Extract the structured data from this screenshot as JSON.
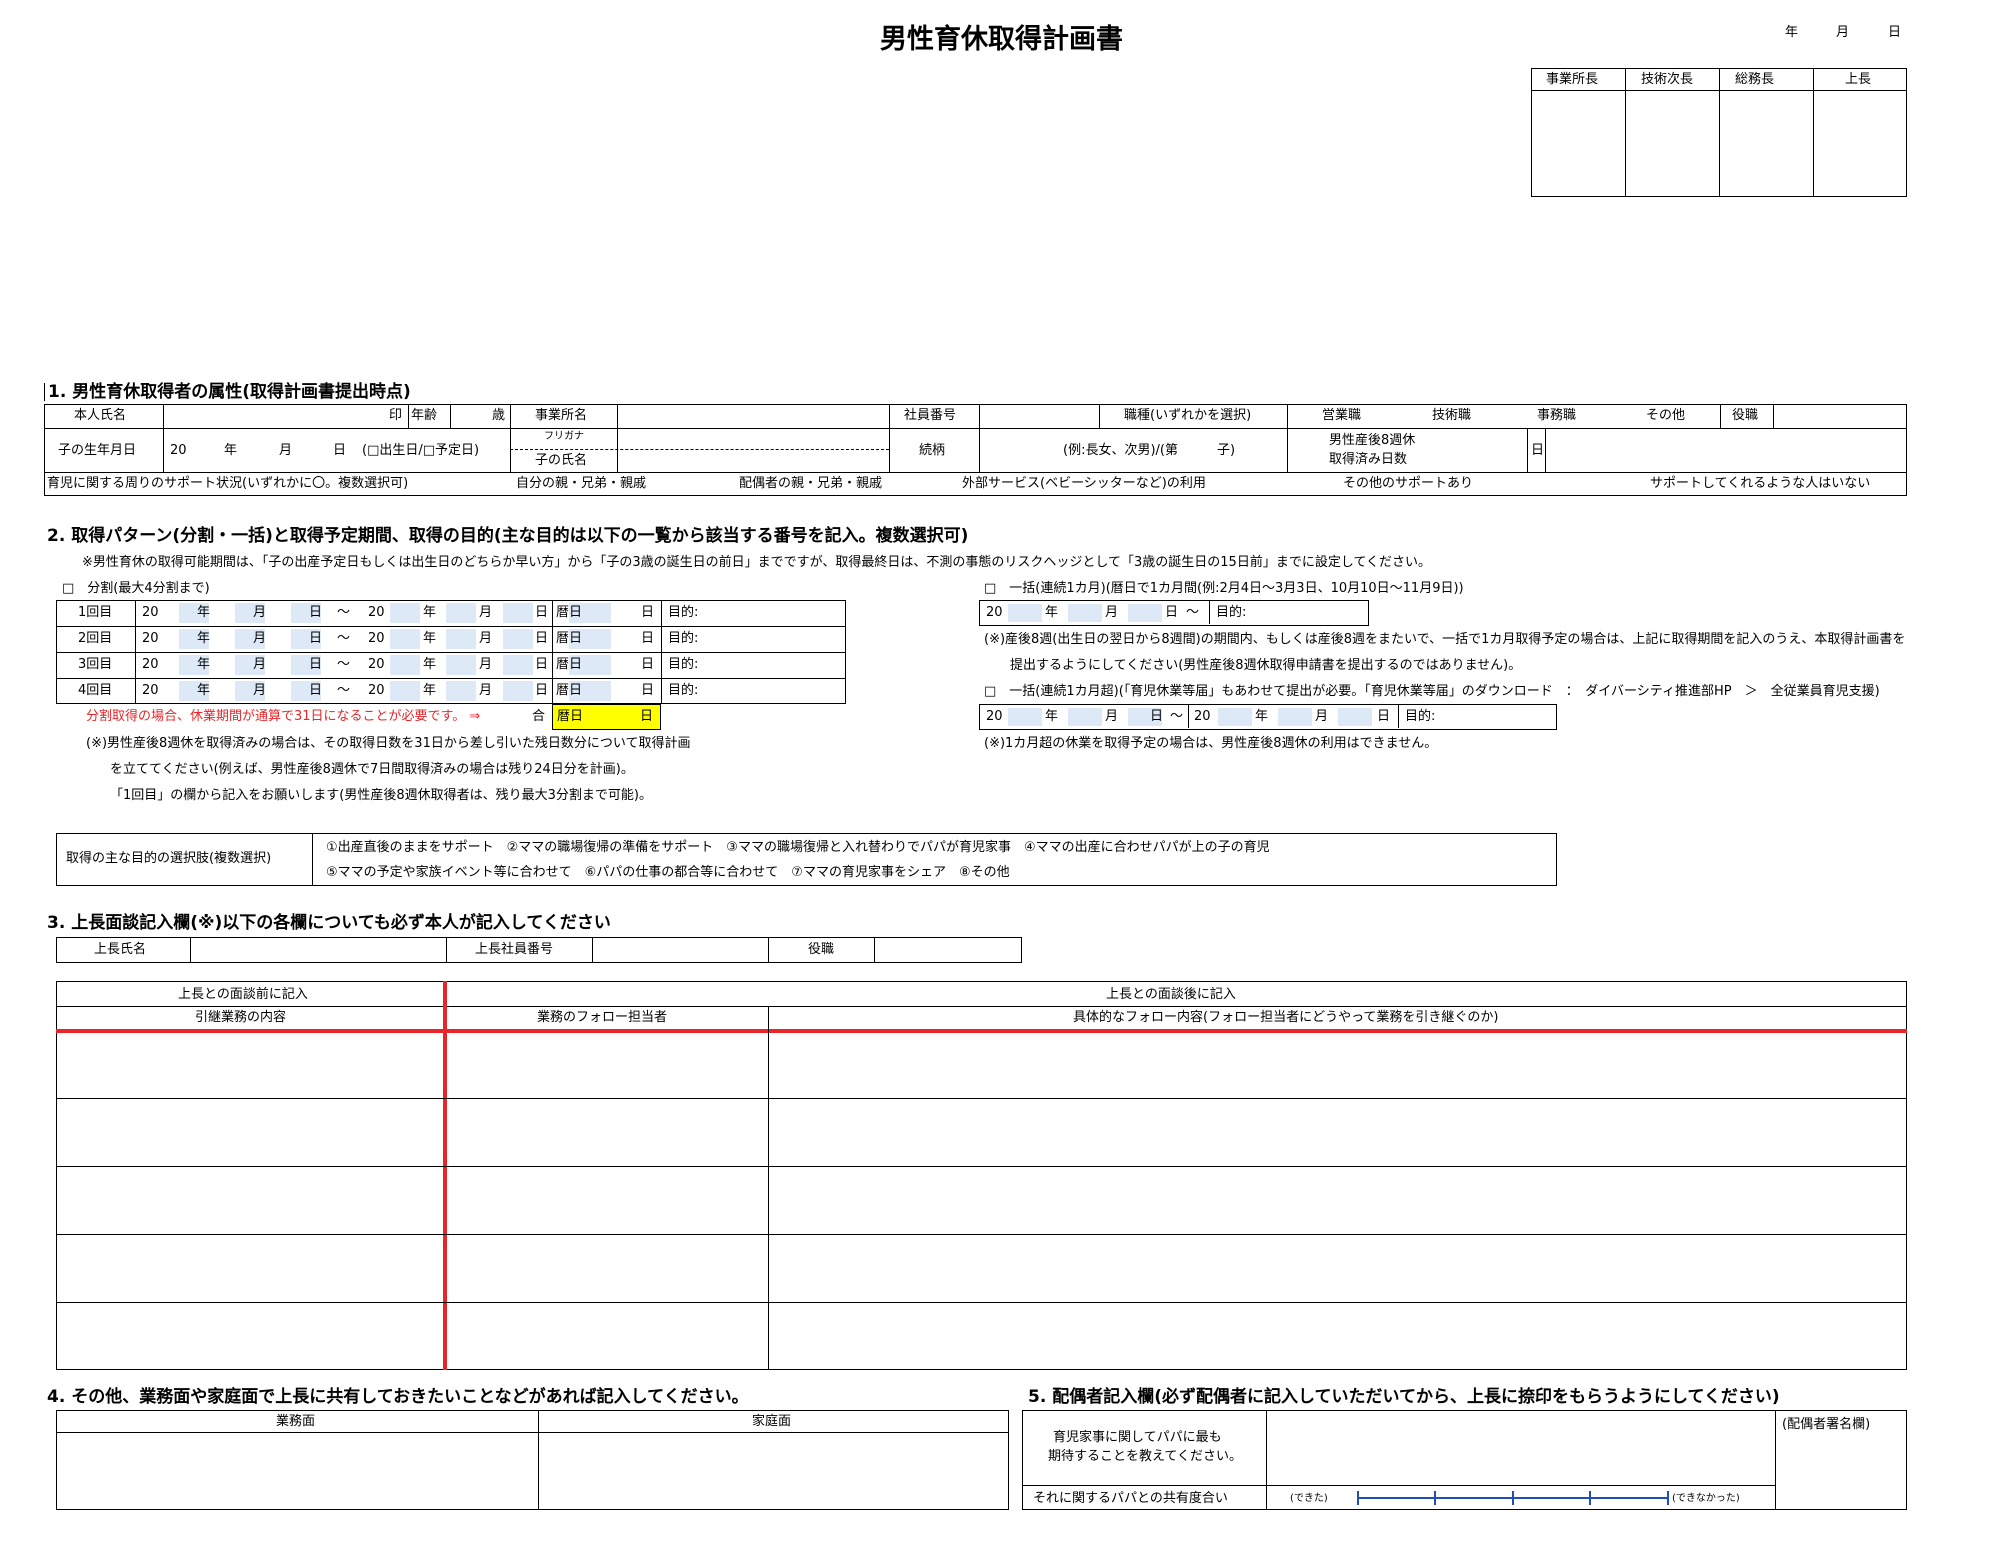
{
  "title": "男性育休取得計画書",
  "date": {
    "year": "年",
    "month": "月",
    "day": "日"
  },
  "approvals": [
    "事業所長",
    "技術次長",
    "総務長",
    "上長"
  ],
  "s1": {
    "heading": "1. 男性育休取得者の属性(取得計画書提出時点)",
    "name_label": "本人氏名",
    "seal": "印",
    "age_label": "年齢",
    "age_unit": "歳",
    "office_label": "事業所名",
    "empno_label": "社員番号",
    "job_label": "職種(いずれかを選択)",
    "jobs": [
      "営業職",
      "技術職",
      "事務職",
      "その他",
      "役職"
    ],
    "dob_label": "子の生年月日",
    "dob_20": "20",
    "dob_y": "年",
    "dob_m": "月",
    "dob_d": "日",
    "dob_opts": "(□出生日/□予定日)",
    "furigana": "フリガナ",
    "child_name": "子の氏名",
    "relation_label": "続柄",
    "relation_ex": "(例:長女、次男)/(第　　　子)",
    "paternity_l1": "男性産後8週休",
    "paternity_l2": "取得済み日数",
    "paternity_unit": "日",
    "support_label": "育児に関する周りのサポート状況(いずれかに〇。複数選択可)",
    "supports": [
      "自分の親・兄弟・親戚",
      "配偶者の親・兄弟・親戚",
      "外部サービス(ベビーシッターなど)の利用",
      "その他のサポートあり",
      "サポートしてくれるような人はいない"
    ]
  },
  "s2": {
    "heading": "2. 取得パターン(分割・一括)と取得予定期間、取得の目的(主な目的は以下の一覧から該当する番号を記入。複数選択可)",
    "note": "※男性育休の取得可能期間は、「子の出産予定日もしくは出生日のどちらか早い方」から「子の3歳の誕生日の前日」までですが、取得最終日は、不測の事態のリスクヘッジとして「3歳の誕生日の15日前」までに設定してください。",
    "split_label": "□　分割(最大4分割まで)",
    "rows": [
      "1回目",
      "2回目",
      "3回目",
      "4回目"
    ],
    "p20": "20",
    "py": "年",
    "pm": "月",
    "pd": "日",
    "tilde": "～",
    "cal": "暦日",
    "cal_d": "日",
    "purpose": "目的:",
    "split_warn": "分割取得の場合、休業期間が通算で31日になることが必要です。 ⇒",
    "split_total": "合",
    "split_total_cal": "暦日",
    "split_total_d": "日",
    "split_note1": "(※)男性産後8週休を取得済みの場合は、その取得日数を31日から差し引いた残日数分について取得計画",
    "split_note2": "を立ててください(例えば、男性産後8週休で7日間取得済みの場合は残り24日分を計画)。",
    "split_note3": "「1回目」の欄から記入をお願いします(男性産後8週休取得者は、残り最大3分割まで可能)。",
    "bulk1_label": "□　一括(連続1カ月)(暦日で1カ月間(例:2月4日～3月3日、10月10日～11月9日))",
    "bulk1_note1": "(※)産後8週(出生日の翌日から8週間)の期間内、もしくは産後8週をまたいで、一括で1カ月取得予定の場合は、上記に取得期間を記入のうえ、本取得計画書を",
    "bulk1_note2": "提出するようにしてください(男性産後8週休取得申請書を提出するのではありません)。",
    "bulk2_label": "□　一括(連続1カ月超)(「育児休業等届」もあわせて提出が必要。「育児休業等届」のダウンロード　：　ダイバーシティ推進部HP　＞　全従業員育児支援)",
    "bulk2_note": "(※)1カ月超の休業を取得予定の場合は、男性産後8週休の利用はできません。",
    "purpose_label": "取得の主な目的の選択肢(複数選択)",
    "purpose_l1": "①出産直後のままをサポート　②ママの職場復帰の準備をサポート　③ママの職場復帰と入れ替わりでパパが育児家事　④ママの出産に合わせパパが上の子の育児",
    "purpose_l2": "⑤ママの予定や家族イベント等に合わせて　⑥パパの仕事の都合等に合わせて　⑦ママの育児家事をシェア　⑧その他"
  },
  "s3": {
    "heading": "3. 上長面談記入欄(※)以下の各欄についても必ず本人が記入してください",
    "boss_name": "上長氏名",
    "boss_no": "上長社員番号",
    "position": "役職",
    "before": "上長との面談前に記入",
    "after": "上長との面談後に記入",
    "col1": "引継業務の内容",
    "col2": "業務のフォロー担当者",
    "col3": "具体的なフォロー内容(フォロー担当者にどうやって業務を引き継ぐのか)"
  },
  "s4": {
    "heading": "4. その他、業務面や家庭面で上長に共有しておきたいことなどがあれば記入してください。",
    "work": "業務面",
    "home": "家庭面"
  },
  "s5": {
    "heading": "5. 配偶者記入欄(必ず配偶者に記入していただいてから、上長に捺印をもらうようにしてください)",
    "q1": "育児家事に関してパパに最も",
    "q2": "期待することを教えてください。",
    "share": "それに関するパパとの共有度合い",
    "can": "(できた)",
    "cannot": "(できなかった)",
    "signature": "(配偶者署名欄)"
  },
  "colors": {
    "accent_red": "#e8262a",
    "input_blue": "#dde9f7",
    "highlight_yellow": "#ffff00",
    "scale_blue": "#1f4fb4"
  }
}
